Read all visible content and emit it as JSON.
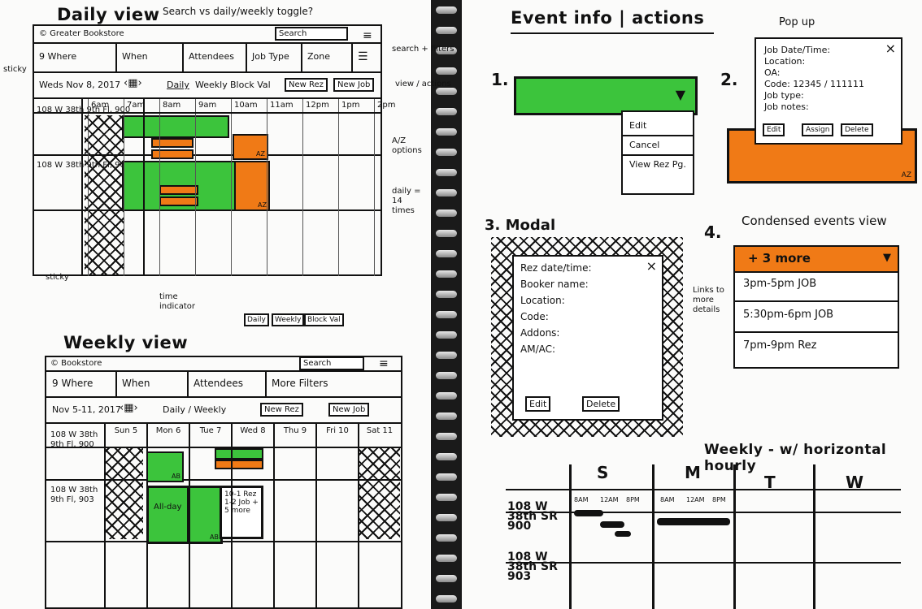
{
  "daily": {
    "title": "Daily view",
    "top_note": "Search vs daily/weekly toggle?",
    "logo": "© Greater Bookstore",
    "search": "Search",
    "filters": [
      "9 Where",
      "When",
      "Attendees",
      "Job Type",
      "Zone"
    ],
    "date": "Weds Nov 8, 2017",
    "toggle": [
      "Daily",
      "Weekly",
      "Block Val"
    ],
    "new_rez": "New Rez",
    "new_job": "New Job",
    "times": [
      "6am",
      "7am",
      "8am",
      "9am",
      "10am",
      "11am",
      "12pm",
      "1pm",
      "2pm"
    ],
    "rows": [
      "108 W 38th 9th Fl, 900",
      "108 W 38th 9th Fl, 903"
    ],
    "side_notes": [
      "search + filters",
      "view / actions",
      "A/Z options",
      "daily = 14 times"
    ],
    "left_note": "sticky",
    "bottom_note": "sticky",
    "time_indicator": "time indicator",
    "mini_toggle": [
      "Daily",
      "Weekly",
      "Block Val"
    ],
    "block_label": "AZ"
  },
  "weekly": {
    "title": "Weekly view",
    "logo": "© Bookstore",
    "search": "Search",
    "filters": [
      "9 Where",
      "When",
      "Attendees",
      "More Filters"
    ],
    "date": "Nov 5-11, 2017",
    "toggle": "Daily / Weekly",
    "new_rez": "New Rez",
    "new_job": "New Job",
    "days": [
      "Sun 5",
      "Mon 6",
      "Tue 7",
      "Wed 8",
      "Thu 9",
      "Fri 10",
      "Sat 11"
    ],
    "rows": [
      "108 W 38th 9th Fl, 900",
      "108 W 38th 9th Fl, 903"
    ],
    "allday": "All-day",
    "more": "10-1 Rez 1-2 Job + 5 more",
    "ab": "AB"
  },
  "event": {
    "title": "Event info | actions",
    "n1": "1.",
    "menu": [
      "Edit",
      "Cancel",
      "View Rez Pg."
    ],
    "n2": "2.",
    "popup_label": "Pop up",
    "popup_fields": [
      "Job Date/Time:",
      "Location:",
      "OA:",
      "Code: 12345 / 111111",
      "Job type:",
      "Job notes:"
    ],
    "popup_buttons": [
      "Edit",
      "Assign",
      "Delete"
    ],
    "az": "AZ",
    "n3": "3. Modal",
    "modal_fields": [
      "Rez date/time:",
      "Booker name:",
      "Location:",
      "Code:",
      "Addons:",
      "AM/AC:"
    ],
    "modal_buttons": [
      "Edit",
      "Delete"
    ],
    "n4": "4.",
    "condensed_title": "Condensed events view",
    "more": "+ 3 more",
    "condensed_items": [
      "3pm-5pm  JOB",
      "5:30pm-6pm  JOB",
      "7pm-9pm  Rez"
    ],
    "links_note": "Links to more details",
    "close": "×"
  },
  "hweekly": {
    "title": "Weekly - w/ horizontal hourly",
    "days": [
      "S",
      "M",
      "T",
      "W"
    ],
    "hours": [
      "8AM",
      "12AM",
      "8PM"
    ],
    "rows": [
      "108 W 38th SR 900",
      "108 W 38th SR 903"
    ]
  }
}
